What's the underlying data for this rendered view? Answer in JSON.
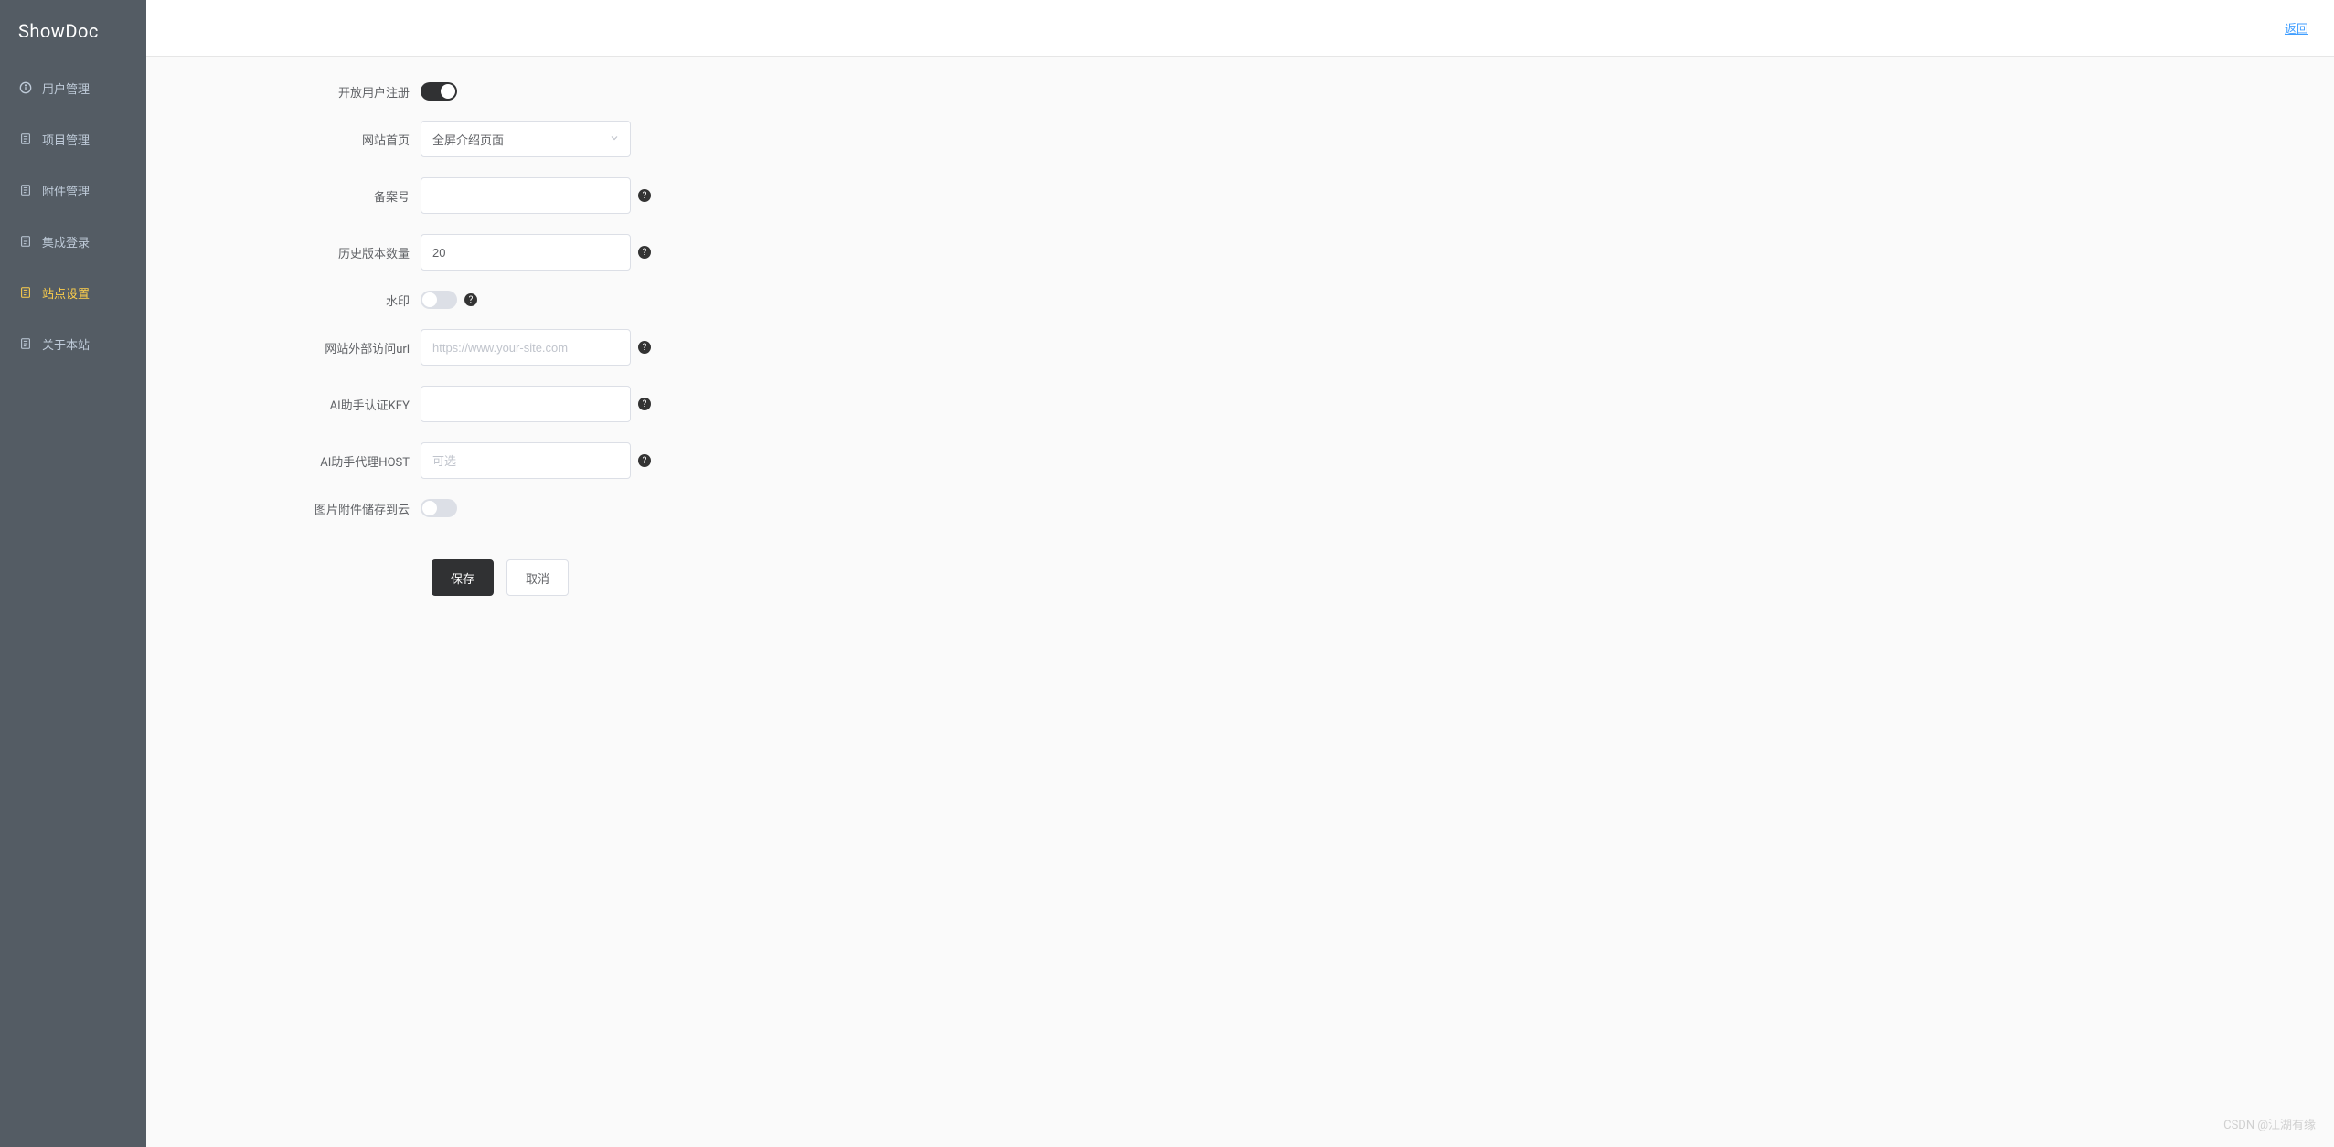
{
  "sidebar": {
    "title": "ShowDoc",
    "items": [
      {
        "label": "用户管理",
        "icon": "info"
      },
      {
        "label": "项目管理",
        "icon": "doc"
      },
      {
        "label": "附件管理",
        "icon": "doc"
      },
      {
        "label": "集成登录",
        "icon": "doc"
      },
      {
        "label": "站点设置",
        "icon": "doc",
        "active": true
      },
      {
        "label": "关于本站",
        "icon": "doc"
      }
    ]
  },
  "header": {
    "back_link": "返回"
  },
  "form": {
    "open_register": {
      "label": "开放用户注册",
      "value": true
    },
    "homepage": {
      "label": "网站首页",
      "selected": "全屏介绍页面"
    },
    "beian": {
      "label": "备案号",
      "value": ""
    },
    "history_count": {
      "label": "历史版本数量",
      "value": "20"
    },
    "watermark": {
      "label": "水印",
      "value": false
    },
    "external_url": {
      "label": "网站外部访问url",
      "value": "",
      "placeholder": "https://www.your-site.com"
    },
    "ai_key": {
      "label": "AI助手认证KEY",
      "value": ""
    },
    "ai_host": {
      "label": "AI助手代理HOST",
      "value": "",
      "placeholder": "可选"
    },
    "cloud_storage": {
      "label": "图片附件储存到云",
      "value": false
    },
    "save_label": "保存",
    "cancel_label": "取消"
  },
  "watermark_text": "CSDN @江湖有缘"
}
